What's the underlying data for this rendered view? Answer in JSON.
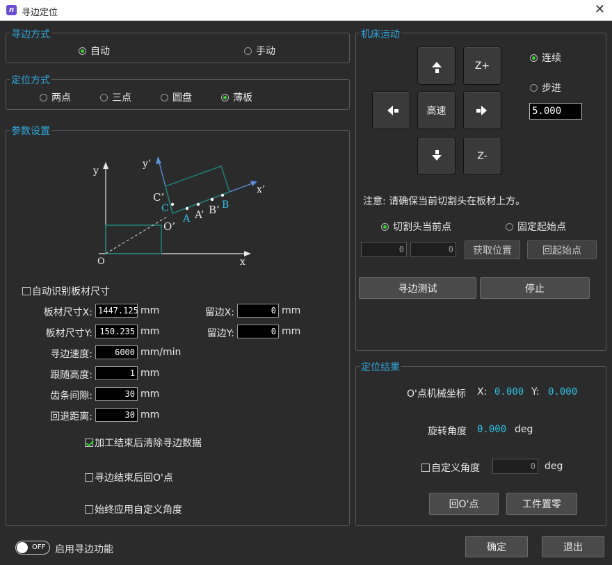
{
  "window": {
    "title": "寻边定位",
    "app_icon_text": "n"
  },
  "edge_mode": {
    "title": "寻边方式",
    "options": [
      "自动",
      "手动"
    ],
    "selected": "自动"
  },
  "locate_mode": {
    "title": "定位方式",
    "options": [
      "两点",
      "三点",
      "圆盘",
      "薄板"
    ],
    "selected": "薄板"
  },
  "params": {
    "title": "参数设置",
    "diagram": {
      "y_axis": "y",
      "x_axis": "x",
      "origin": "O",
      "y_prime": "y’",
      "x_prime": "x’",
      "o_prime": "O’",
      "c_prime": "C’",
      "c": "C",
      "a": "A",
      "a_prime": "A’",
      "b_prime": "B’",
      "b": "B"
    },
    "auto_size": {
      "label": "自动识别板材尺寸",
      "checked": false
    },
    "size_x": {
      "label": "板材尺寸X:",
      "value": "1447.125",
      "unit": "mm"
    },
    "size_y": {
      "label": "板材尺寸Y:",
      "value": "150.235",
      "unit": "mm"
    },
    "margin_x": {
      "label": "留边X:",
      "value": "0",
      "unit": "mm"
    },
    "margin_y": {
      "label": "留边Y:",
      "value": "0",
      "unit": "mm"
    },
    "speed": {
      "label": "寻边速度:",
      "value": "6000",
      "unit": "mm/min"
    },
    "height": {
      "label": "跟随高度:",
      "value": "1",
      "unit": "mm"
    },
    "gap": {
      "label": "齿条间隙:",
      "value": "30",
      "unit": "mm"
    },
    "retreat": {
      "label": "回退距离:",
      "value": "30",
      "unit": "mm"
    },
    "clear_after": {
      "label": "加工结束后清除寻边数据",
      "checked": true
    },
    "return_o": {
      "label": "寻边结束后回O'点",
      "checked": false
    },
    "always_angle": {
      "label": "始终应用自定义角度",
      "checked": false
    }
  },
  "machine": {
    "title": "机床运动",
    "up": "▲",
    "down": "▼",
    "left": "◀",
    "right": "▶",
    "z_plus": "Z+",
    "z_minus": "Z-",
    "fast": "高速",
    "continuous": "连续",
    "step": "步进",
    "mode": "连续",
    "step_value": "5.000",
    "notice": "注意: 请确保当前切割头在板材上方。",
    "start_options": [
      "切割头当前点",
      "固定起始点"
    ],
    "start_selected": "切割头当前点",
    "pos_x": "0",
    "pos_y": "0",
    "get_pos": "获取位置",
    "return_start": "回起始点",
    "edge_test": "寻边测试",
    "stop": "停止"
  },
  "result": {
    "title": "定位结果",
    "coord_label": "O'点机械坐标",
    "x_label": "X:",
    "x_value": "0.000",
    "y_label": "Y:",
    "y_value": "0.000",
    "angle_label": "旋转角度",
    "angle_value": "0.000",
    "angle_unit": "deg",
    "custom_angle": {
      "label": "自定义角度",
      "checked": false,
      "value": "0",
      "unit": "deg"
    },
    "return_o_btn": "回O'点",
    "zero_btn": "工件置零"
  },
  "footer": {
    "toggle_text": "OFF",
    "toggle_label": "启用寻边功能",
    "ok": "确定",
    "exit": "退出"
  },
  "colors": {
    "accent": "#2fa8e0",
    "radio_on": "#34d12f",
    "value_cyan": "#2fc2e8",
    "diagram_teal": "#1e7f72",
    "diagram_blue": "#5b8ed8"
  }
}
